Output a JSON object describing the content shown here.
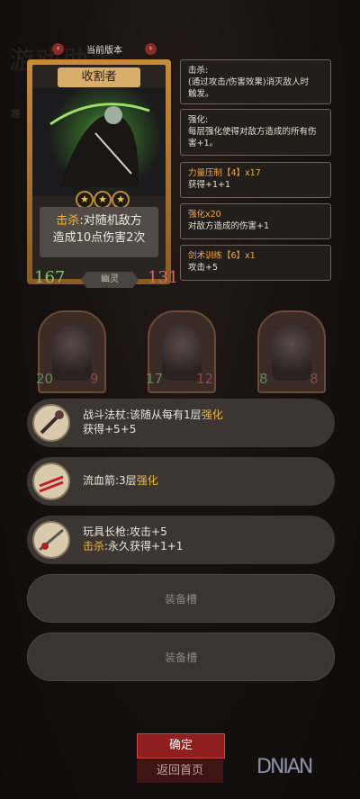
{
  "background": {
    "title": "游戏助手",
    "subtitle": "难"
  },
  "version": {
    "label": "当前版本",
    "prev": "‹",
    "next": "›"
  },
  "card": {
    "name": "收割者",
    "stars": [
      "★",
      "★",
      "★"
    ],
    "desc_keyword": "击杀",
    "desc_line1": ":对随机敌方",
    "desc_line2": "造成10点伤害2次",
    "attack": "167",
    "health": "131",
    "race": "幽灵"
  },
  "panels": [
    {
      "title": "击杀:",
      "lines": [
        "(通过攻击/伤害效果)消灭敌人时",
        "触发。"
      ]
    },
    {
      "title": "强化:",
      "lines": [
        "每层强化使得对敌方造成的所有伤",
        "害+1。"
      ]
    },
    {
      "title": "力量压制【4】x17",
      "lines": [
        "获得+1+1"
      ]
    },
    {
      "title": "强化x20",
      "lines": [
        "对敌方造成的伤害+1"
      ]
    },
    {
      "title": "剑术训练【6】x1",
      "lines": [
        "攻击+5"
      ]
    }
  ],
  "minions": [
    {
      "attack": "20",
      "health": "9"
    },
    {
      "attack": "17",
      "health": "12"
    },
    {
      "attack": "8",
      "health": "8"
    }
  ],
  "equipment": [
    {
      "name": "战斗法杖",
      "line1_a": "战斗法杖:该随从每有1层",
      "line1_kw": "强化",
      "line2": "获得+5+5"
    },
    {
      "name": "流血箭",
      "line1_a": "流血箭:3层",
      "line1_kw": "强化"
    },
    {
      "name": "玩具长枪",
      "line1_a": "玩具长枪:攻击+5",
      "line2_kw": "击杀",
      "line2": ":永久获得+1+1"
    }
  ],
  "empty_slot_label": "装备槽",
  "buttons": {
    "confirm": "确定",
    "back": "返回首页"
  },
  "watermark": "DNIAN"
}
